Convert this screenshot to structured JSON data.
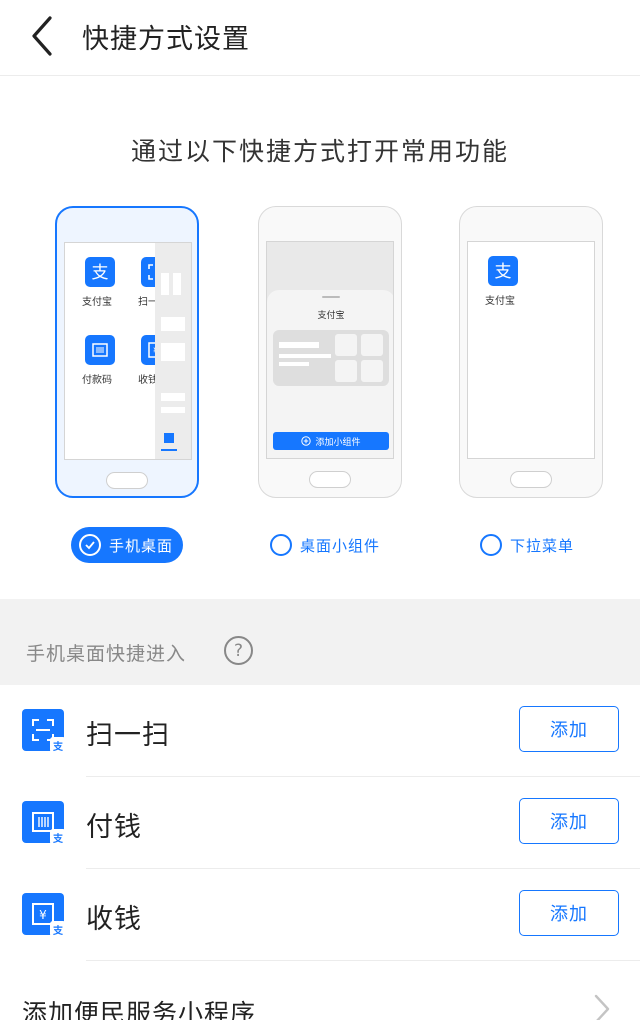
{
  "header": {
    "title": "快捷方式设置"
  },
  "intro": "通过以下快捷方式打开常用功能",
  "phones": {
    "desktop": {
      "apps": [
        "支付宝",
        "扫一",
        "付款码",
        "收钱"
      ]
    },
    "widget": {
      "title": "支付宝",
      "add_label": "添加小组件"
    },
    "dropdown": {
      "app": "支付宝"
    }
  },
  "options": [
    {
      "label": "手机桌面",
      "selected": true
    },
    {
      "label": "桌面小组件",
      "selected": false
    },
    {
      "label": "下拉菜单",
      "selected": false
    }
  ],
  "section": {
    "title": "手机桌面快捷进入",
    "help": "?"
  },
  "rows": [
    {
      "label": "扫一扫",
      "icon": "scan-icon",
      "button": "添加"
    },
    {
      "label": "付钱",
      "icon": "barcode-icon",
      "button": "添加"
    },
    {
      "label": "收钱",
      "icon": "receive-money-icon",
      "button": "添加"
    }
  ],
  "bottom": {
    "label": "添加便民服务小程序"
  },
  "colors": {
    "accent": "#1677ff",
    "section_bg": "#f2f2f2"
  }
}
